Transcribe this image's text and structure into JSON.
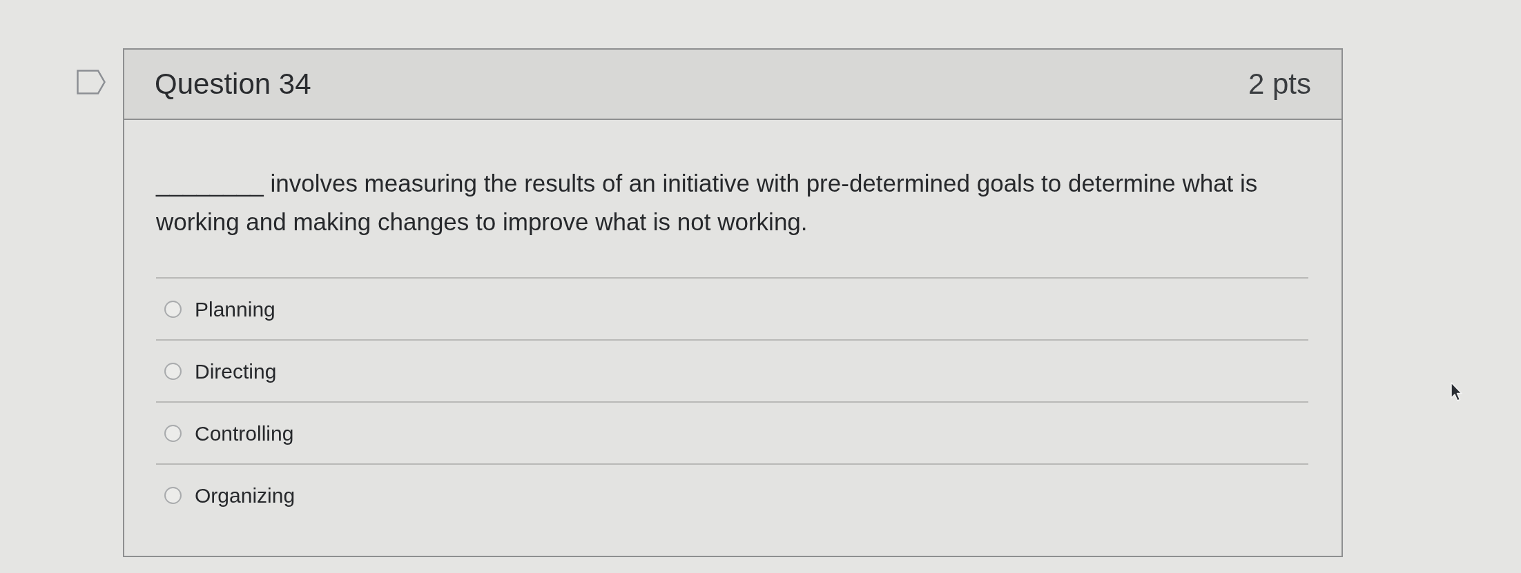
{
  "question": {
    "flagged": false,
    "title": "Question 34",
    "points": "2 pts",
    "text": "________ involves measuring the results of an initiative with pre-determined goals to determine what is working and making changes to improve what is not working.",
    "answers": [
      {
        "label": "Planning",
        "selected": false
      },
      {
        "label": "Directing",
        "selected": false
      },
      {
        "label": "Controlling",
        "selected": false
      },
      {
        "label": "Organizing",
        "selected": false
      }
    ]
  }
}
